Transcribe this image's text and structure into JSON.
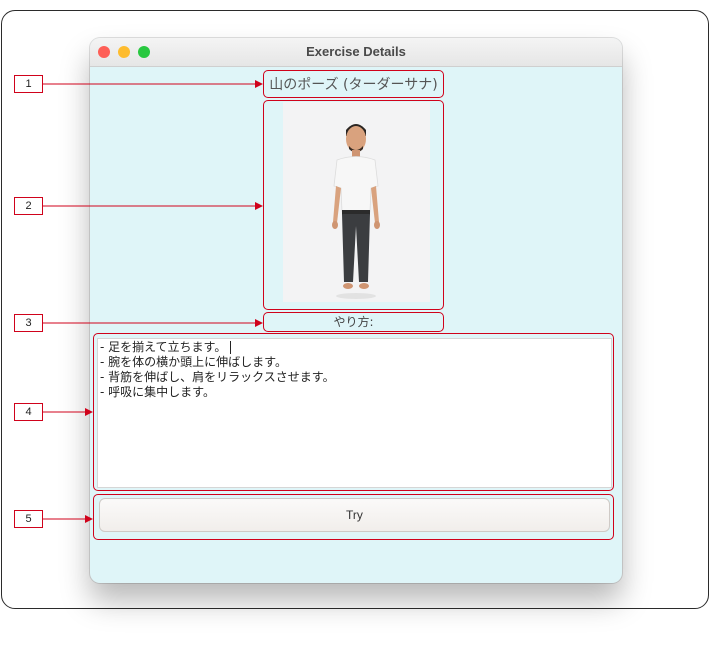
{
  "window": {
    "title": "Exercise Details"
  },
  "exercise": {
    "title": "山のポーズ (ターダーサナ)",
    "image_icon": "person-standing-icon",
    "howto_label": "やり方:",
    "instructions": [
      "- 足を揃えて立ちます。",
      "- 腕を体の横か頭上に伸ばします。",
      "- 背筋を伸ばし、肩をリラックスさせます。",
      "- 呼吸に集中します。"
    ],
    "try_label": "Try"
  },
  "annotations": {
    "labels": [
      "1",
      "2",
      "3",
      "4",
      "5"
    ]
  },
  "colors": {
    "window_bg": "#dff5f8",
    "annotation": "#d0021b"
  }
}
